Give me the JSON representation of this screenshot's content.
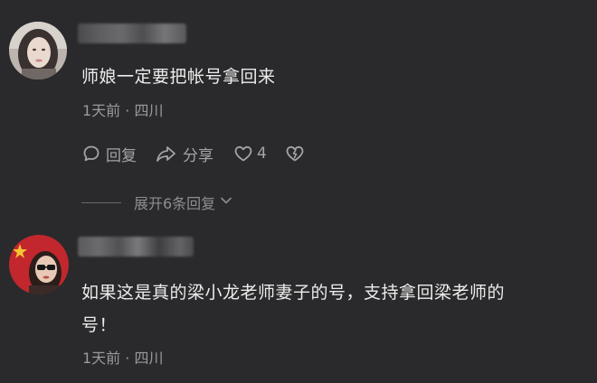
{
  "comments": [
    {
      "text": "师娘一定要把帐号拿回来",
      "time_location": "1天前 · 四川",
      "actions": {
        "reply_label": "回复",
        "share_label": "分享",
        "like_count": "4"
      }
    },
    {
      "text_line1": "如果这是真的梁小龙老师妻子的号，支持拿回梁老师的",
      "text_line2": "号！",
      "time_location": "1天前 · 四川"
    }
  ],
  "expand_replies": {
    "label": "展开6条回复"
  },
  "colors": {
    "background": "#2a2a2c",
    "text_primary": "#ececec",
    "text_secondary": "#9a9a9c"
  },
  "icons": [
    "comment-icon",
    "share-icon",
    "heart-icon",
    "broken-heart-icon",
    "chevron-down-icon"
  ]
}
